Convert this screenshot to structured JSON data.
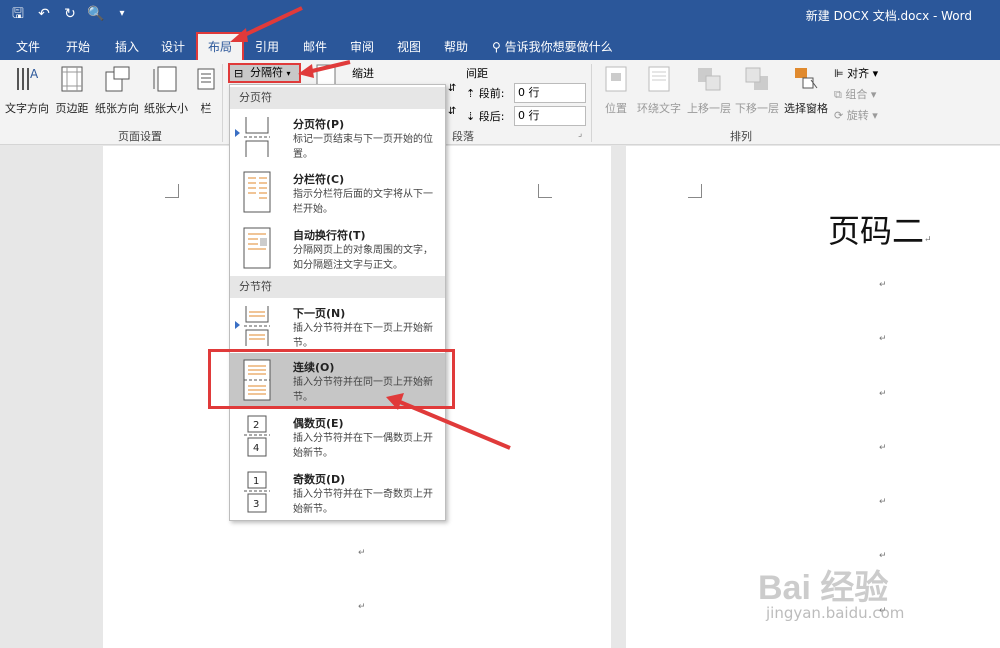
{
  "titlebar": {
    "document_title": "新建 DOCX 文档.docx  -  Word",
    "qat": [
      "save-icon",
      "undo-icon",
      "redo-icon",
      "print-preview-icon",
      "customize-icon"
    ]
  },
  "tabs": [
    "文件",
    "开始",
    "插入",
    "设计",
    "布局",
    "引用",
    "邮件",
    "审阅",
    "视图",
    "帮助"
  ],
  "active_tab": "布局",
  "tell_me": "告诉我你想要做什么",
  "ribbon": {
    "page_setup": {
      "buttons": [
        "文字方向",
        "页边距",
        "纸张方向",
        "纸张大小",
        "栏"
      ],
      "label": "页面设置"
    },
    "breaks_button": "分隔符",
    "indent_label": "缩进",
    "spacing_label": "间距",
    "before_label": "段前:",
    "before_value": "0 行",
    "after_label": "段后:",
    "after_value": "0 行",
    "paragraph_label": "段落",
    "arrange": {
      "buttons": [
        "位置",
        "环绕文字",
        "上移一层",
        "下移一层",
        "选择窗格"
      ],
      "small": [
        "对齐",
        "组合",
        "旋转"
      ],
      "label": "排列"
    }
  },
  "breaks_menu": {
    "page_breaks_header": "分页符",
    "section_breaks_header": "分节符",
    "items": [
      {
        "title": "分页符(P)",
        "desc": "标记一页结束与下一页开始的位置。"
      },
      {
        "title": "分栏符(C)",
        "desc": "指示分栏符后面的文字将从下一栏开始。"
      },
      {
        "title": "自动换行符(T)",
        "desc": "分隔网页上的对象周围的文字，如分隔题注文字与正文。"
      },
      {
        "title": "下一页(N)",
        "desc": "插入分节符并在下一页上开始新节。"
      },
      {
        "title": "连续(O)",
        "desc": "插入分节符并在同一页上开始新节。"
      },
      {
        "title": "偶数页(E)",
        "desc": "插入分节符并在下一偶数页上开始新节。"
      },
      {
        "title": "奇数页(D)",
        "desc": "插入分节符并在下一奇数页上开始新节。"
      }
    ]
  },
  "document": {
    "page2_text": "页码二",
    "para_mark": "↵"
  },
  "watermark": {
    "brand": "Bai 经验",
    "url": "jingyan.baidu.com"
  },
  "colors": {
    "accent": "#2b579a",
    "annotation": "#e03a3a"
  }
}
